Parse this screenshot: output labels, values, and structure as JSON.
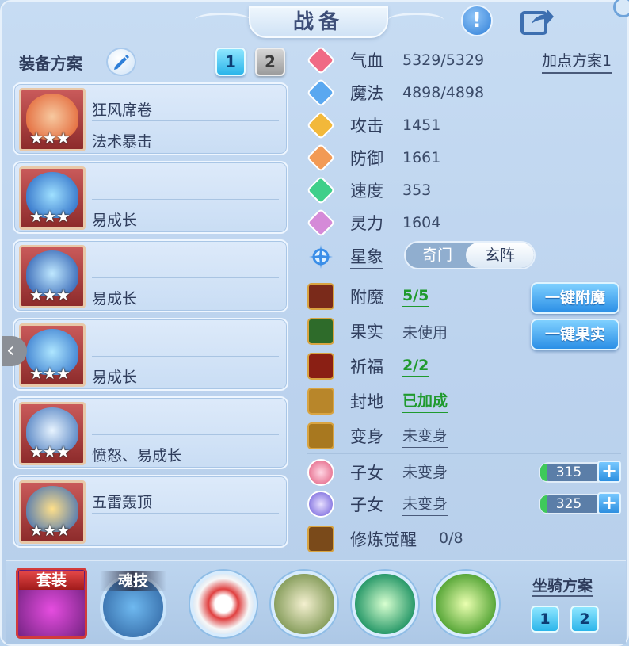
{
  "title": "战备",
  "left": {
    "plan_label": "装备方案",
    "plan_buttons": [
      "1",
      "2"
    ],
    "equipment": [
      {
        "name": "狂风席卷",
        "effect": "法术暴击",
        "stars": "★★★",
        "art_color": "#f07a3a"
      },
      {
        "name": "",
        "effect": "易成长",
        "stars": "★★★",
        "art_color": "#2d7ed8"
      },
      {
        "name": "",
        "effect": "易成长",
        "stars": "★★★",
        "art_color": "#3a78d0"
      },
      {
        "name": "",
        "effect": "易成长",
        "stars": "★★★",
        "art_color": "#3f8ee0"
      },
      {
        "name": "",
        "effect": "愤怒、易成长",
        "stars": "★★★",
        "art_color": "#5b8fd8"
      },
      {
        "name": "五雷轰顶",
        "effect": "",
        "stars": "★★★",
        "art_color": "#4a90e0"
      }
    ]
  },
  "right": {
    "point_plan": "加点方案1",
    "stats": [
      {
        "label": "气血",
        "value": "5329/5329",
        "icon": "heart-icon",
        "color": "#f06a85"
      },
      {
        "label": "魔法",
        "value": "4898/4898",
        "icon": "magic-icon",
        "color": "#5aa8f0"
      },
      {
        "label": "攻击",
        "value": "1451",
        "icon": "attack-icon",
        "color": "#f2b83a"
      },
      {
        "label": "防御",
        "value": "1661",
        "icon": "defense-icon",
        "color": "#f29a55"
      },
      {
        "label": "速度",
        "value": "353",
        "icon": "speed-icon",
        "color": "#3fcf8a"
      },
      {
        "label": "灵力",
        "value": "1604",
        "icon": "spirit-icon",
        "color": "#d58ad8"
      }
    ],
    "xingxiang": {
      "label": "星象",
      "tab_a": "奇门",
      "tab_b": "玄阵"
    },
    "features": [
      {
        "label": "附魔",
        "value": "5/5",
        "green": true
      },
      {
        "label": "果实",
        "value": "未使用",
        "green": false
      },
      {
        "label": "祈福",
        "value": "2/2",
        "green": true
      },
      {
        "label": "封地",
        "value": "已加成",
        "green": true
      },
      {
        "label": "变身",
        "value": "未变身",
        "green": false
      }
    ],
    "buttons": {
      "enchant": "一键附魔",
      "fruit": "一键果实"
    },
    "children": [
      {
        "label": "子女",
        "value": "未变身",
        "bar": "315"
      },
      {
        "label": "子女",
        "value": "未变身",
        "bar": "325"
      }
    ],
    "awaken": {
      "label": "修炼觉醒",
      "value": "0/8"
    }
  },
  "bottom": {
    "set_label": "套装",
    "soul_label": "魂技",
    "mount_label": "坐骑方案",
    "mount_buttons": [
      "1",
      "2"
    ]
  },
  "colors": {
    "accent": "#2bb5ea",
    "green": "#1f9a2d",
    "panel": "#c7dcf3"
  }
}
